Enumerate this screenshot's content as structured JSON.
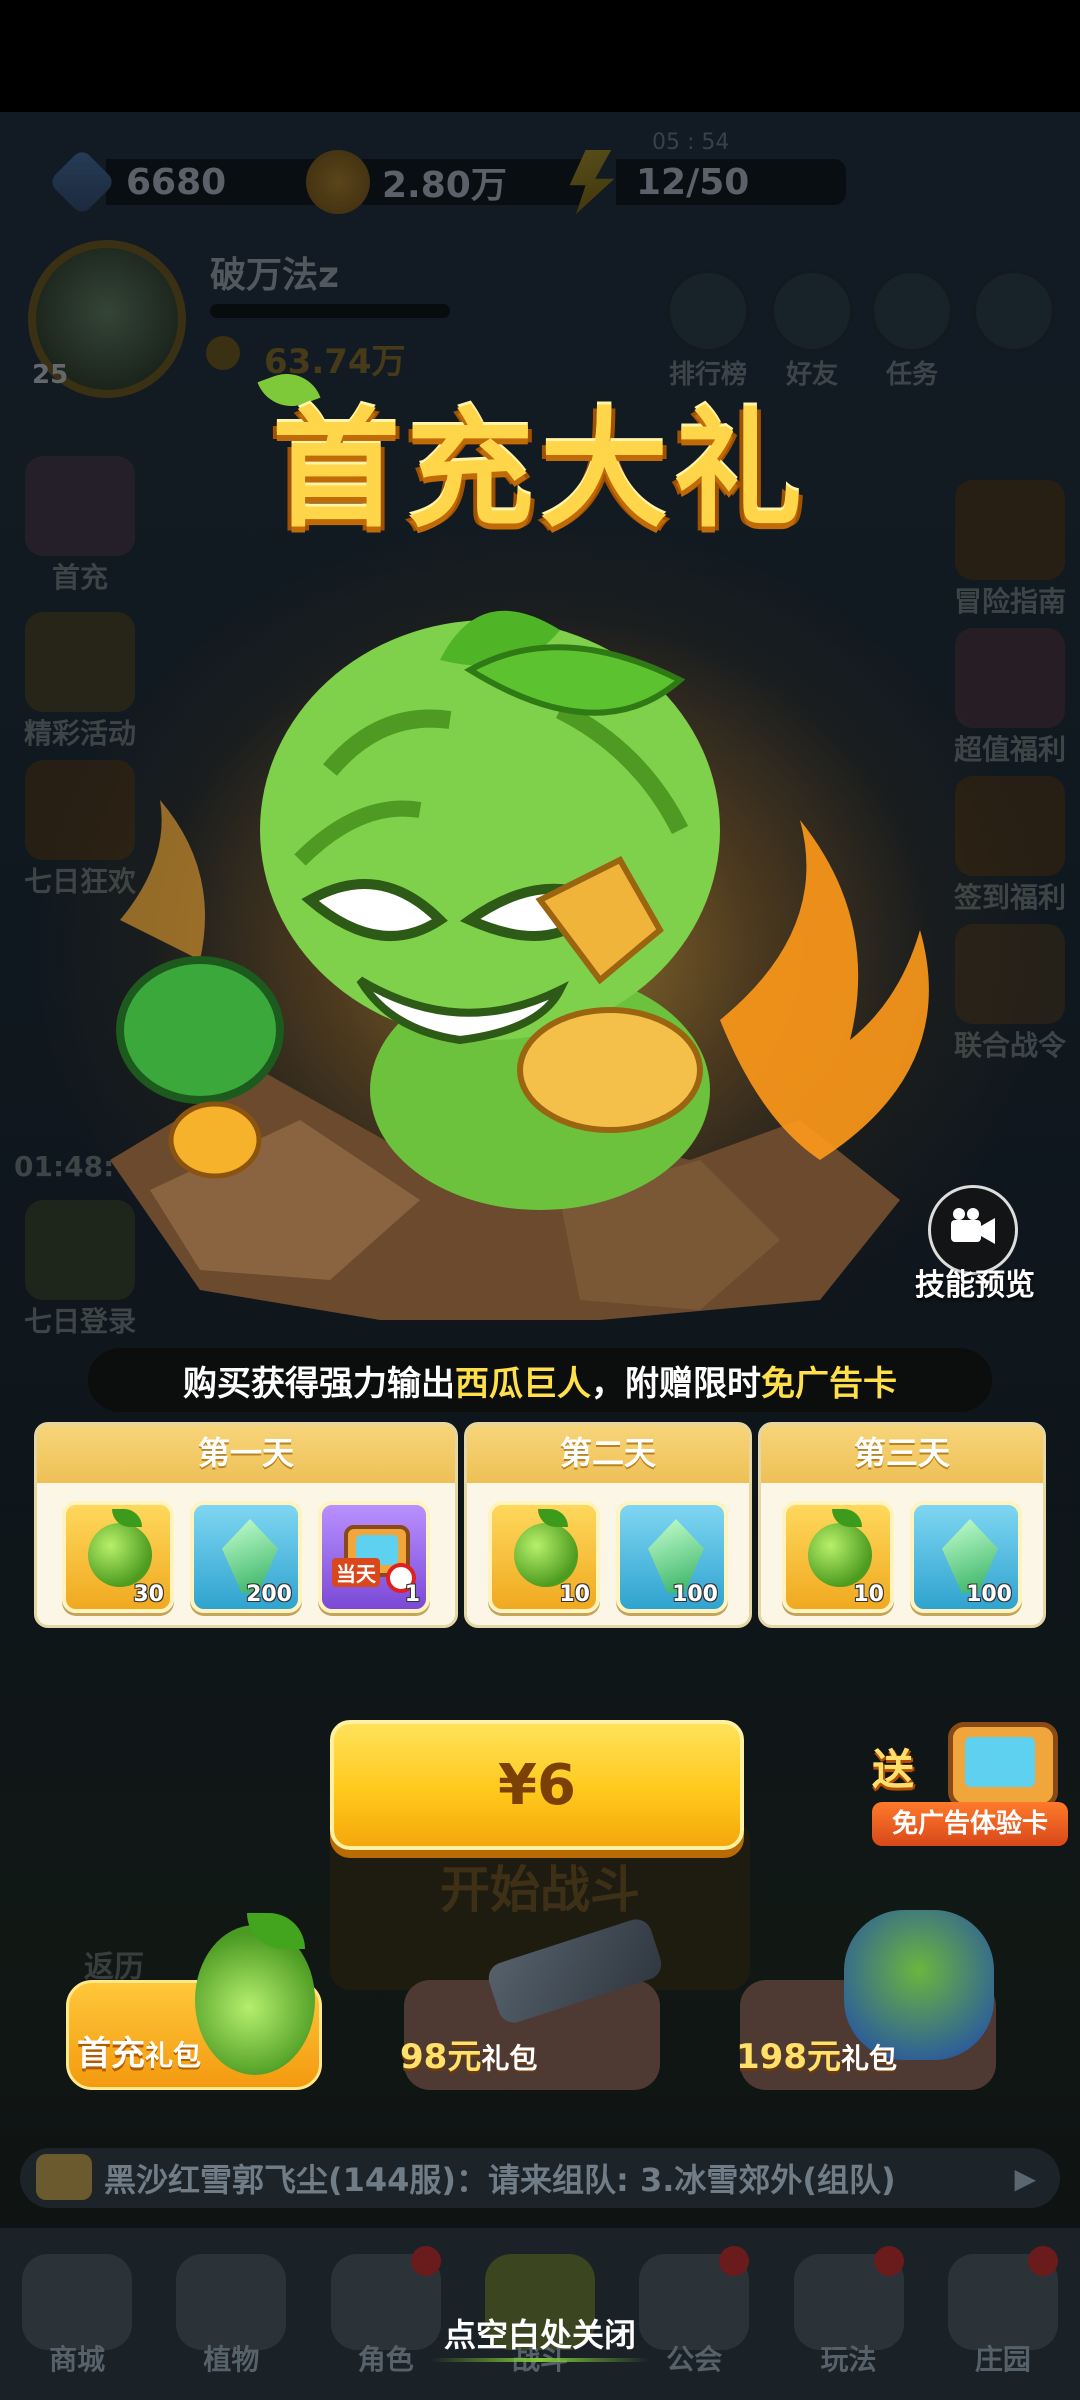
{
  "resources": {
    "gems": "6680",
    "gold": "2.80万",
    "energy": "12/50",
    "energy_timer": "05 : 54"
  },
  "player": {
    "level": "25",
    "name": "破万法z",
    "power": "63.74万"
  },
  "top_buttons": [
    "排行榜",
    "好友",
    "任务"
  ],
  "side_left": [
    "首充",
    "精彩活动",
    "七日狂欢",
    "01:48:",
    "七日登录"
  ],
  "side_right": [
    "冒险指南",
    "超值福利",
    "签到福利",
    "联合战令"
  ],
  "popup": {
    "title": "首充大礼",
    "skill_preview": "技能预览",
    "banner": {
      "prefix": "购买获得强力输出",
      "hero": "西瓜巨人",
      "mid": "，附赠限时",
      "card": "免广告卡"
    },
    "days": [
      {
        "label": "第一天",
        "items": [
          {
            "type": "hero-shard",
            "qty": "30"
          },
          {
            "type": "crystal",
            "qty": "200"
          },
          {
            "type": "ad-free-card",
            "qty": "1",
            "tag": "当天"
          }
        ]
      },
      {
        "label": "第二天",
        "items": [
          {
            "type": "hero-shard",
            "qty": "10"
          },
          {
            "type": "crystal",
            "qty": "100"
          }
        ]
      },
      {
        "label": "第三天",
        "items": [
          {
            "type": "hero-shard",
            "qty": "10"
          },
          {
            "type": "crystal",
            "qty": "100"
          }
        ]
      }
    ],
    "price": "¥6",
    "gift": {
      "send": "送",
      "card": "免广告体验卡"
    }
  },
  "background": {
    "start_battle": "开始战斗",
    "fanli": "返历"
  },
  "packs": [
    {
      "amount": "首充",
      "suffix": "礼包"
    },
    {
      "amount": "98元",
      "suffix": "礼包"
    },
    {
      "amount": "198元",
      "suffix": "礼包"
    }
  ],
  "chat": "黑沙红雪郭飞尘(144服)：请来组队: 3.冰雪郊外(组队)",
  "nav": [
    "商城",
    "植物",
    "角色",
    "战斗",
    "公会",
    "玩法",
    "庄园"
  ],
  "close_hint": "点空白处关闭",
  "colors": {
    "accent_gold": "#ffc91c",
    "title_gold": "#ffd54a",
    "highlight_yellow": "#ffe04a",
    "card_bg": "#fbf6e6"
  }
}
